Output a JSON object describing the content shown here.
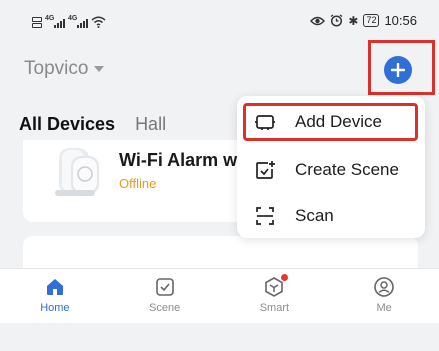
{
  "status_bar": {
    "net_type_1": "4G",
    "net_type_2": "4G",
    "battery": "72",
    "time": "10:56",
    "icons": [
      "sim-icon",
      "signal-icon",
      "wifi-icon",
      "eye-icon",
      "alarm-icon",
      "bluetooth-icon",
      "battery-icon"
    ]
  },
  "header": {
    "home_name": "Topvico",
    "add_button_icon": "plus-icon"
  },
  "tabs": [
    {
      "label": "All Devices",
      "active": true
    },
    {
      "label": "Hall",
      "active": false
    }
  ],
  "device": {
    "name": "Wi-Fi Alarm w",
    "status": "Offline"
  },
  "menu": {
    "items": [
      {
        "label": "Add Device",
        "icon": "add-device-icon",
        "highlighted": true
      },
      {
        "label": "Create Scene",
        "icon": "create-scene-icon",
        "highlighted": false
      },
      {
        "label": "Scan",
        "icon": "scan-icon",
        "highlighted": false
      }
    ]
  },
  "bottom_nav": {
    "items": [
      {
        "label": "Home",
        "icon": "home-icon",
        "active": true
      },
      {
        "label": "Scene",
        "icon": "scene-icon",
        "active": false
      },
      {
        "label": "Smart",
        "icon": "smart-icon",
        "active": false,
        "badge_dot": true
      },
      {
        "label": "Me",
        "icon": "profile-icon",
        "active": false
      }
    ]
  },
  "colors": {
    "accent": "#2f6fd6",
    "highlight_outline": "#d9312b",
    "offline": "#e89a1c",
    "badge": "#e5392e"
  }
}
